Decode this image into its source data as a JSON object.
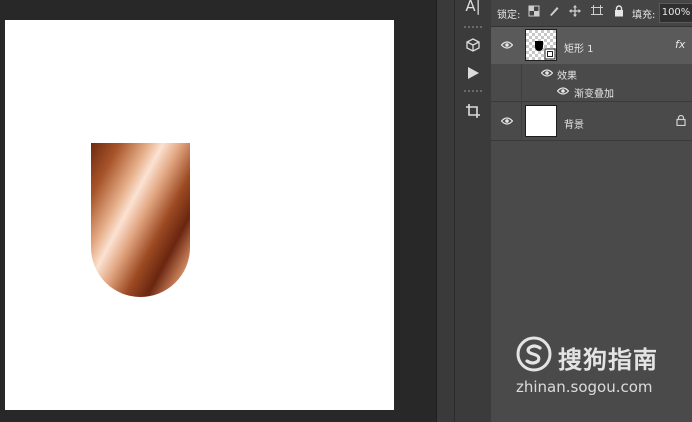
{
  "canvas": {
    "background": "#ffffff",
    "shape_gradient_colors": [
      "#6e2a10",
      "#fbe2d2",
      "#6a2610",
      "#f7d8c2"
    ]
  },
  "toolbar": {
    "tools": [
      {
        "name": "text-tool",
        "icon": "A|"
      },
      {
        "name": "3d-tool",
        "icon": "cube-icon"
      },
      {
        "name": "play-tool",
        "icon": "play-icon"
      },
      {
        "name": "crop-tool",
        "icon": "crop-icon"
      }
    ]
  },
  "layers_panel": {
    "lock_label": "锁定:",
    "fill_label": "填充:",
    "fill_value": "100%",
    "layers": [
      {
        "name": "矩形 1",
        "fx": "fx",
        "selected": true
      },
      {
        "name": "背景",
        "locked": true
      }
    ],
    "effects_label": "效果",
    "effect_item": "渐变叠加"
  },
  "watermark": {
    "brand": "搜狗指南",
    "url": "zhinan.sogou.com"
  }
}
